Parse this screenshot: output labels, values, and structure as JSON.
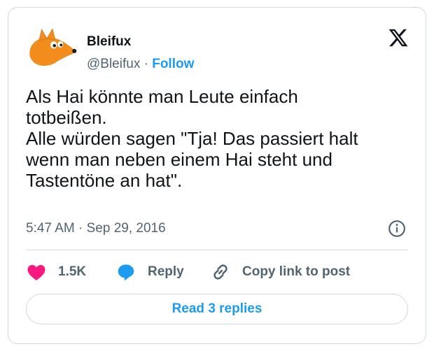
{
  "author": {
    "name": "Bleifux",
    "handle": "@Bleifux",
    "separator": "·",
    "follow_label": "Follow",
    "avatar_icon": "orange-fox-avatar"
  },
  "brand": {
    "logo_icon": "x-logo-icon"
  },
  "tweet": {
    "lines": [
      "Als Hai könnte man Leute einfach",
      "totbeißen.",
      "Alle würden sagen \"Tja! Das passiert halt",
      "wenn man neben einem Hai steht und",
      "Tastentöne an hat\"."
    ]
  },
  "meta": {
    "time": "5:47 AM",
    "separator": "·",
    "date": "Sep 29, 2016",
    "info_icon": "info-icon"
  },
  "actions": {
    "like_count": "1.5K",
    "reply_label": "Reply",
    "copy_label": "Copy link to post"
  },
  "read_replies_label": "Read 3 replies",
  "colors": {
    "accent": "#1d9bf0",
    "like": "#f91880",
    "text": "#0f1419",
    "muted": "#536471",
    "border": "#cfd9de",
    "avatar": "#f28c1c"
  }
}
